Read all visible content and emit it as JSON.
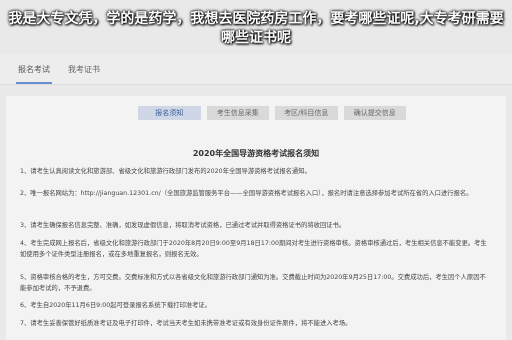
{
  "overlay_title": "我是大专文凭，学的是药学，我想去医院药房工作，要考哪些证呢,大专考研需要哪些证书呢",
  "top_tabs": [
    "报名考试",
    "我考证书"
  ],
  "steps": [
    "报名须知",
    "考生信息采集",
    "考区/科目信息",
    "确认提交信息"
  ],
  "notice": {
    "title": "2020年全国导游资格考试报名须知",
    "items": [
      "1、请考生认真阅读文化和旅游部、省级文化和旅游行政部门发布的2020年全国导游资格考试报名通知。",
      "2、唯一报名网站为：http://jianguan.12301.cn/（全国旅游监管服务平台——全国导游资格考试报名入口），报名时请注意选择参加考试所在省的入口进行报名。",
      "3、请考生确保报名信息完整、准确，如发现虚假信息，将取消考试资格，已通过考试并取得资格证书的将收回证书。",
      "4、考生完成网上报名后，省级文化和旅游行政部门于2020年8月20日9:00至9月18日17:00期间对考生进行资格审核。资格审核通过后，考生相关信息不能变更。考生如使用多个证件类型注册报名，或在多地重复报名，则报名无效。",
      "5、资格审核合格的考生，方可交费。交费标准和方式以各省级文化和旅游行政部门通知为准。交费截止时间为2020年9月25日17:00。交费成功后，考生因个人原因不能参加考试的，不予退费。",
      "6、考生自2020年11月6日9:00起可登录报名系统下载打印准考证。",
      "7、请考生妥善保管好纸质准考证及电子打印件，考试当天考生如未携带准考证或有效身份证件原件，将不能进入考场。"
    ]
  }
}
